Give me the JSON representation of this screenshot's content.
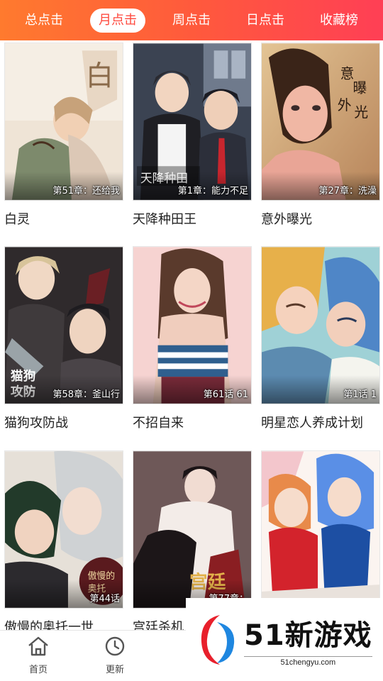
{
  "tabs": [
    {
      "label": "总点击",
      "active": false
    },
    {
      "label": "月点击",
      "active": true
    },
    {
      "label": "周点击",
      "active": false
    },
    {
      "label": "日点击",
      "active": false
    },
    {
      "label": "收藏榜",
      "active": false
    }
  ],
  "comics": [
    {
      "title": "白灵",
      "chapter": "第51章：还给我"
    },
    {
      "title": "天降种田王",
      "chapter": "第1章：能力不足"
    },
    {
      "title": "意外曝光",
      "chapter": "第27章：洗澡"
    },
    {
      "title": "猫狗攻防战",
      "chapter": "第58章：釜山行"
    },
    {
      "title": "不招自来",
      "chapter": "第61话 61"
    },
    {
      "title": "明星恋人养成计划",
      "chapter": "第1话 1"
    },
    {
      "title": "傲慢的奥托一世",
      "chapter": "第44话"
    },
    {
      "title": "宫廷杀机",
      "chapter": "第77章："
    },
    {
      "title": "",
      "chapter": ""
    }
  ],
  "bottom_nav": [
    {
      "label": "首页",
      "icon": "home-icon"
    },
    {
      "label": "更新",
      "icon": "clock-icon"
    }
  ],
  "watermark": {
    "main": "51新游戏",
    "sub": "51chengyu.com"
  },
  "colors": {
    "header_start": "#ff7a2e",
    "header_end": "#ff3f55",
    "active_tab_text": "#ff4a3f"
  }
}
